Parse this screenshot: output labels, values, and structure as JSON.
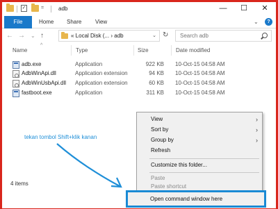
{
  "window": {
    "title": "adb",
    "minimize_glyph": "—",
    "maximize_glyph": "☐",
    "close_glyph": "✕",
    "border_color": "#d9261c"
  },
  "ribbon": {
    "tabs": [
      "File",
      "Home",
      "Share",
      "View"
    ],
    "expand_glyph": "⌄",
    "help_glyph": "?",
    "accent": "#1979ca"
  },
  "nav": {
    "back": "←",
    "forward": "→",
    "recent": "⌄",
    "up": "↑",
    "address": "« Local Disk (...  ›  adb",
    "address_dd": "⌄",
    "refresh": "↻",
    "search_placeholder": "Search adb"
  },
  "columns": [
    "Name",
    "Type",
    "Size",
    "Date modified"
  ],
  "files": [
    {
      "name": "adb.exe",
      "type": "Application",
      "size": "922 KB",
      "date": "10-Oct-15 04:58 AM",
      "icon": "exe"
    },
    {
      "name": "AdbWinApi.dll",
      "type": "Application extension",
      "size": "94 KB",
      "date": "10-Oct-15 04:58 AM",
      "icon": "dll"
    },
    {
      "name": "AdbWinUsbApi.dll",
      "type": "Application extension",
      "size": "60 KB",
      "date": "10-Oct-15 04:58 AM",
      "icon": "dll"
    },
    {
      "name": "fastboot.exe",
      "type": "Application",
      "size": "311 KB",
      "date": "10-Oct-15 04:58 AM",
      "icon": "exe"
    }
  ],
  "status": {
    "count": "4 items"
  },
  "annotation": {
    "text": "tekan tombol Shift+klik kanan",
    "color": "#1f8fd8"
  },
  "context_menu": {
    "items": [
      {
        "label": "View",
        "submenu": true,
        "disabled": false
      },
      {
        "label": "Sort by",
        "submenu": true,
        "disabled": false
      },
      {
        "label": "Group by",
        "submenu": true,
        "disabled": false
      },
      {
        "label": "Refresh",
        "submenu": false,
        "disabled": false
      },
      {
        "label": "Customize this folder...",
        "submenu": false,
        "disabled": false
      },
      {
        "label": "Paste",
        "submenu": false,
        "disabled": true
      },
      {
        "label": "Paste shortcut",
        "submenu": false,
        "disabled": true
      }
    ],
    "submenu_glyph": "›",
    "highlighted_item": "Open command window here"
  }
}
